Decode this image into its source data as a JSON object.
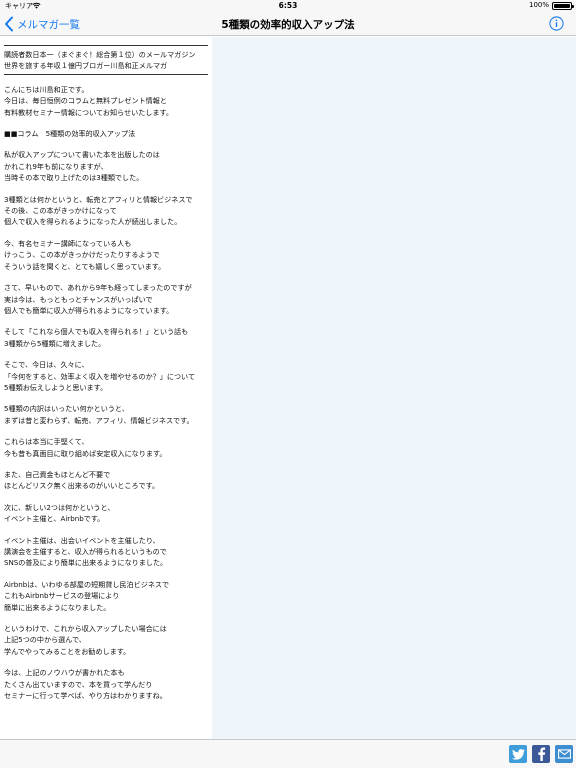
{
  "status_bar": {
    "carrier": "キャリア",
    "time": "6:53",
    "battery": "100%"
  },
  "nav": {
    "back_label": "メルマガ一覧",
    "title": "5種類の効率的収入アップ法",
    "back_icon": "chevron-left-icon",
    "info_icon": "info-icon"
  },
  "article": {
    "header": [
      "購読者数日本一（まぐまぐ！総合第１位）のメールマガジン",
      "世界を旅する年収１億円ブロガー川島和正メルマガ"
    ],
    "paragraphs": [
      [
        "こんにちは川島和正です。",
        "今日は、毎日恒例のコラムと無料プレゼント情報と",
        "有料教材セミナー情報についてお知らせいたします。"
      ],
      [
        "■■コラム　5種類の効率的収入アップ法"
      ],
      [
        "私が収入アップについて書いた本を出版したのは",
        "かれこれ9年も前になりますが、",
        "当時その本で取り上げたのは3種類でした。"
      ],
      [
        "3種類とは何かというと、転売とアフィリと情報ビジネスで",
        "その後、この本がきっかけになって",
        "個人で収入を得られるようになった人が続出しました。"
      ],
      [
        "今、有名セミナー講師になっている人も",
        "けっこう、この本がきっかけだったりするようで",
        "そういう話を聞くと、とても嬉しく思っています。"
      ],
      [
        "さて、早いもので、あれから9年も経ってしまったのですが",
        "実は今は、もっともっとチャンスがいっぱいで",
        "個人でも簡単に収入が得られるようになっています。"
      ],
      [
        "そして「これなら個人でも収入を得られる！」という話も",
        "3種類から5種類に増えました。"
      ],
      [
        "そこで、今日は、久々に、",
        "「今何をすると、効率よく収入を増やせるのか？」について",
        "5種類お伝えしようと思います。"
      ],
      [
        "5種類の内訳はいったい何かというと、",
        "まずは昔と変わらず、転売、アフィリ、情報ビジネスです。"
      ],
      [
        "これらは本当に手堅くて、",
        "今も昔も真面目に取り組めば安定収入になります。"
      ],
      [
        "また、自己資金もほとんど不要で",
        "ほとんどリスク無く出来るのがいいところです。"
      ],
      [
        "次に、新しい2つは何かというと、",
        "イベント主催と、Airbnbです。"
      ],
      [
        "イベント主催は、出会いイベントを主催したり、",
        "講演会を主催すると、収入が得られるというもので",
        "SNSの普及により簡単に出来るようになりました。"
      ],
      [
        "Airbnbは、いわゆる部屋の短期貸し民泊ビジネスで",
        "これもAirbnbサービスの登場により",
        "簡単に出来るようになりました。"
      ],
      [
        "というわけで、これから収入アップしたい場合には",
        "上記5つの中から選んで、",
        "学んでやってみることをお勧めします。"
      ],
      [
        "今は、上記のノウハウが書かれた本も",
        "たくさん出ていますので、本を買って学んだり",
        "セミナーに行って学べば、やり方はわかりますね。"
      ]
    ]
  },
  "toolbar": {
    "twitter_icon": "twitter-icon",
    "facebook_icon": "facebook-icon",
    "mail_icon": "mail-icon"
  },
  "colors": {
    "accent": "#1478f0",
    "right_pane": "#eef6fb",
    "twitter": "#3f9ed9",
    "facebook": "#3b5998",
    "mail": "#3c8ed1"
  }
}
